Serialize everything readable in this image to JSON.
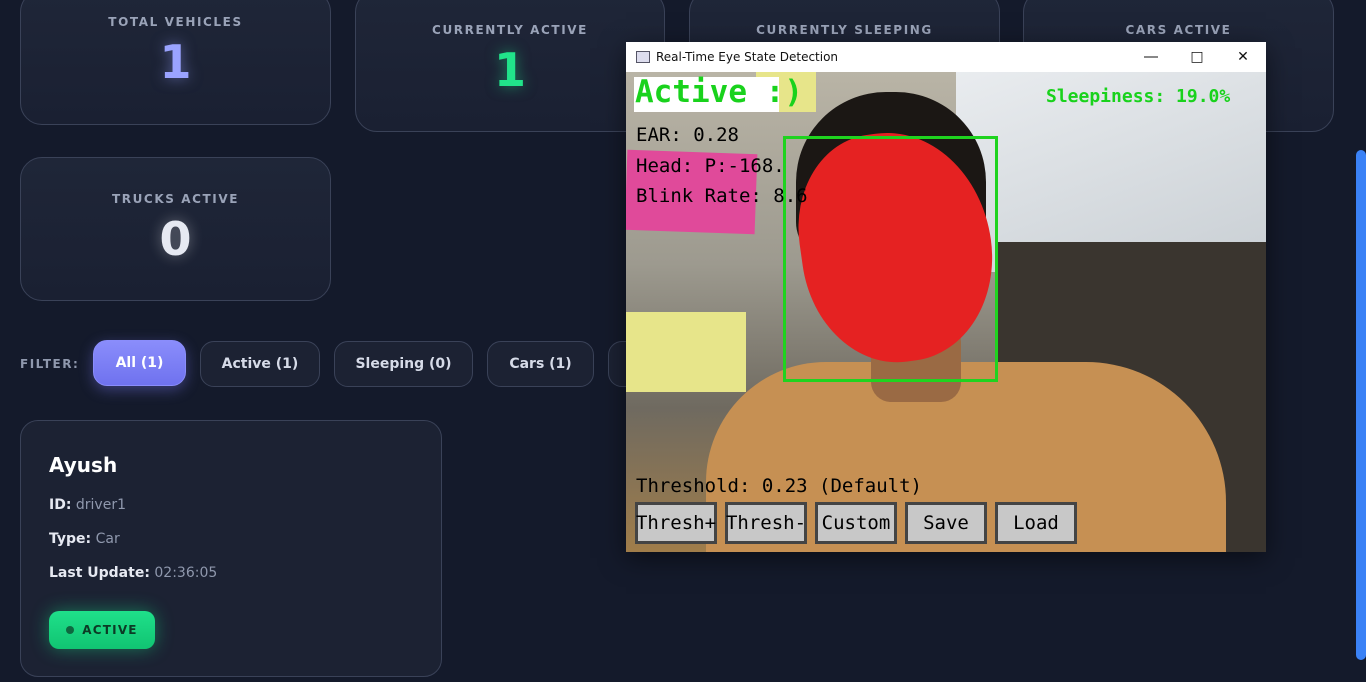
{
  "stats": [
    {
      "label": "TOTAL VEHICLES",
      "value": "1",
      "color": "#9aa3ff"
    },
    {
      "label": "CURRENTLY ACTIVE",
      "value": "1",
      "color": "#21e38a"
    },
    {
      "label": "CURRENTLY SLEEPING",
      "value": ""
    },
    {
      "label": "CARS ACTIVE",
      "value": ""
    },
    {
      "label": "TRUCKS ACTIVE",
      "value": "0",
      "color": "#e6e9f2"
    }
  ],
  "filter": {
    "label": "FILTER:",
    "buttons": [
      "All (1)",
      "Active (1)",
      "Sleeping (0)",
      "Cars (1)"
    ]
  },
  "driver": {
    "name": "Ayush",
    "id_label": "ID:",
    "id_value": "driver1",
    "type_label": "Type:",
    "type_value": "Car",
    "update_label": "Last Update:",
    "update_value": "02:36:05",
    "status": "ACTIVE"
  },
  "window": {
    "title": "Real-Time Eye State Detection",
    "state_text": "Active :)",
    "sleepiness": "Sleepiness: 19.0%",
    "ear": "EAR: 0.28",
    "head": "Head: P:-168.",
    "blink": "Blink Rate: 8.6",
    "threshold": "Threshold: 0.23 (Default)",
    "buttons": [
      "Thresh+",
      "Thresh-",
      "Custom",
      "Save",
      "Load"
    ]
  }
}
